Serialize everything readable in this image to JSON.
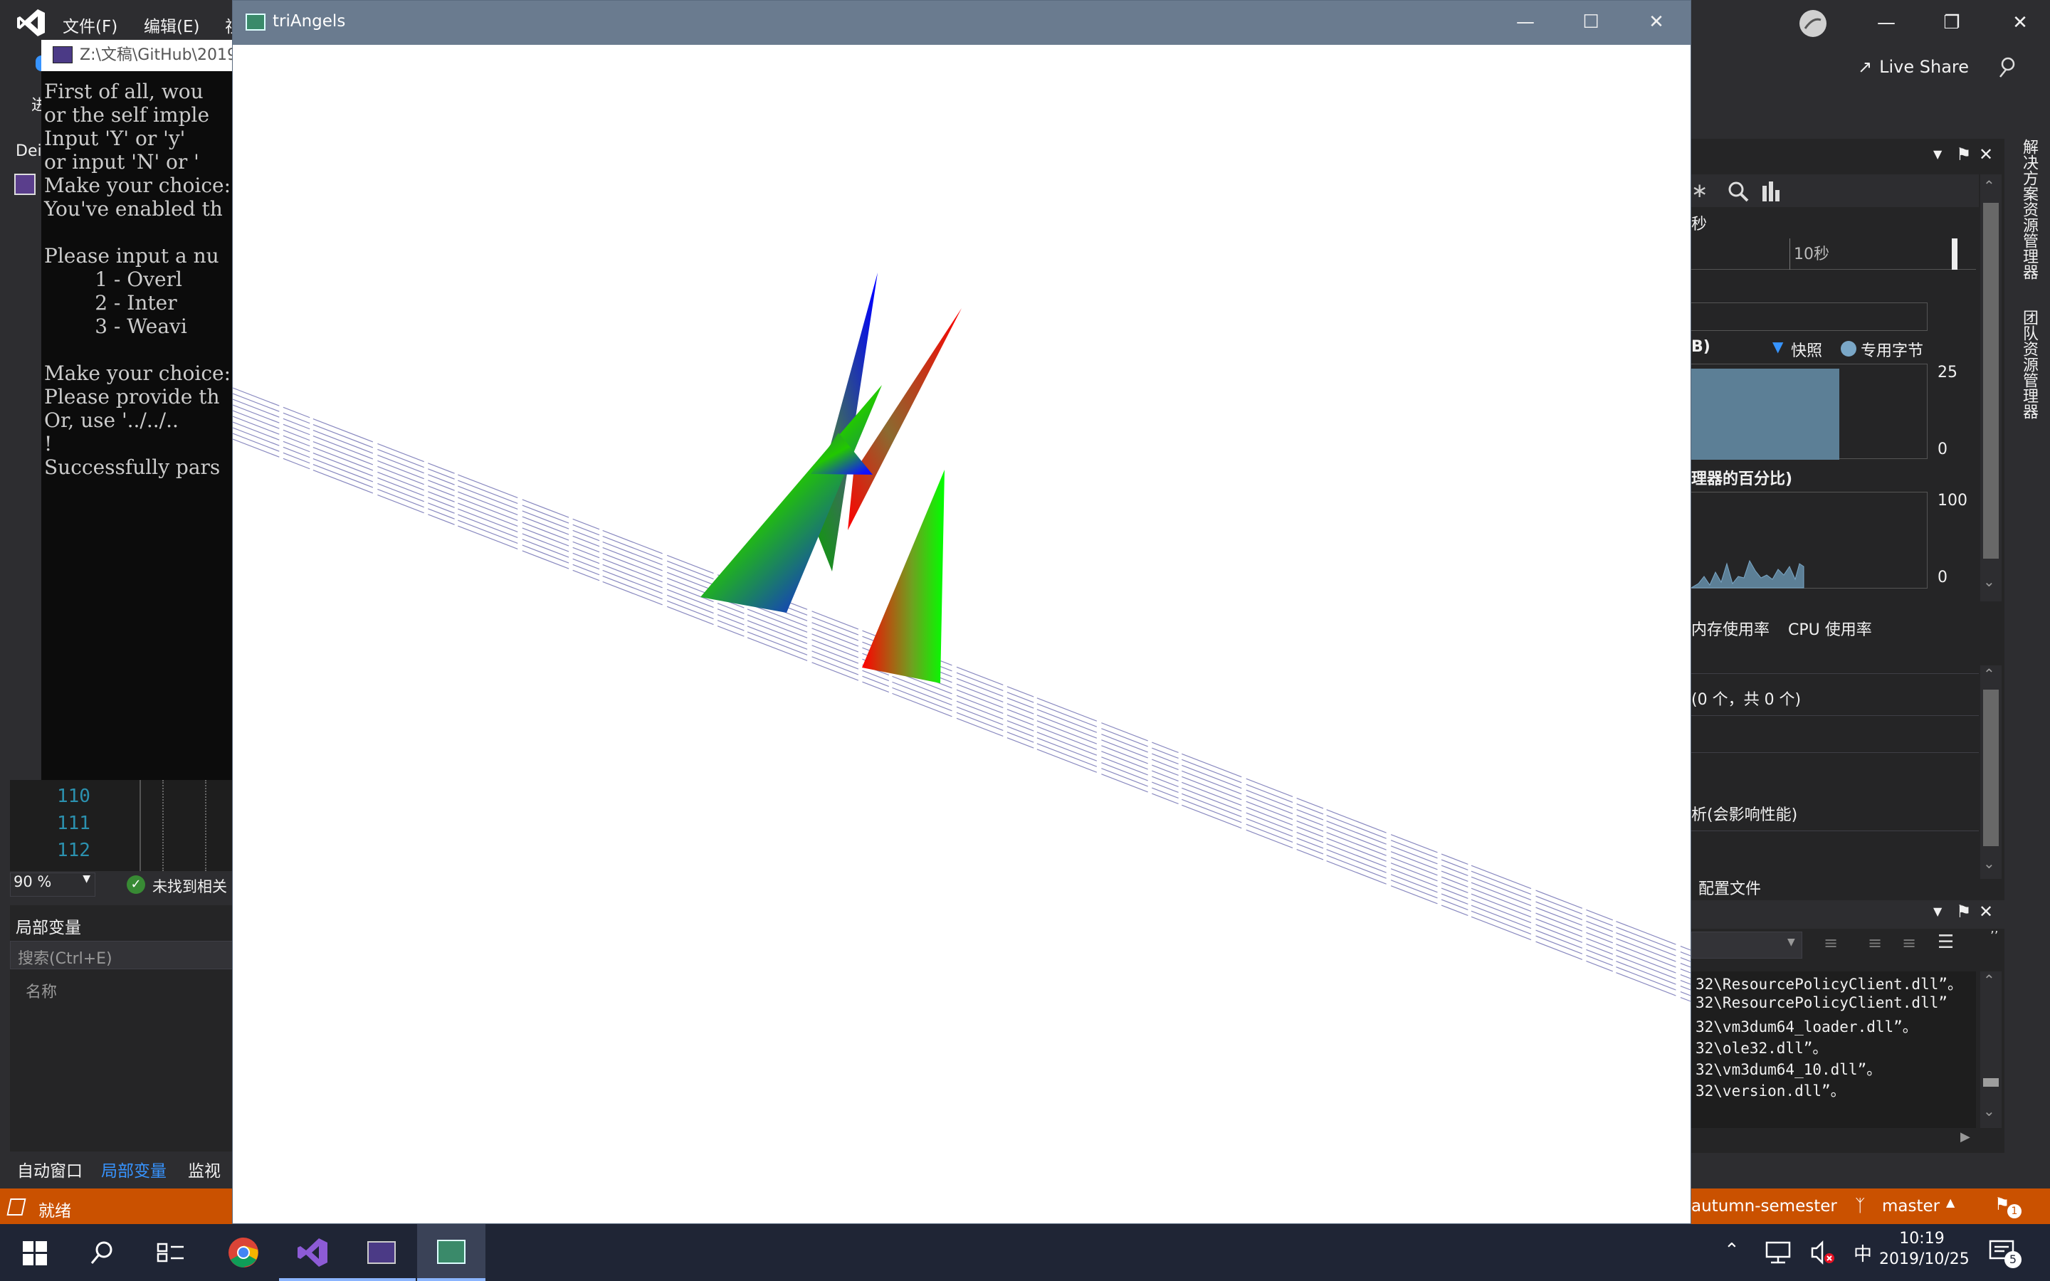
{
  "vs": {
    "menu": [
      "文件(F)",
      "编辑(E)",
      "视"
    ],
    "liveshare_label": "Live Share",
    "debug_tab_stub": "Dei",
    "toolbar_stub": "进"
  },
  "console": {
    "title": "Z:\\文稿\\GitHub\\2019",
    "lines": [
      "First of all, wou",
      "or the self imple",
      "Input 'Y' or 'y'",
      "or input 'N' or '",
      "Make your choice:",
      "You've enabled th",
      "",
      "Please input a nu",
      "        1 - Overl",
      "        2 - Inter",
      "        3 - Weavi",
      "",
      "Make your choice:",
      "Please provide th",
      "Or, use '../../..",
      "!",
      "Successfully pars"
    ]
  },
  "editor": {
    "line_numbers": [
      "110",
      "111",
      "112"
    ],
    "zoom": "90 %",
    "status_text": "未找到相关"
  },
  "locals": {
    "title": "局部变量",
    "search_placeholder": "搜索(Ctrl+E)",
    "column_name": "名称"
  },
  "debug_tabs": [
    "自动窗口",
    "局部变量",
    "监视"
  ],
  "glwindow": {
    "title": "triAngels"
  },
  "diagnostics": {
    "timeline_label": "10秒",
    "sec_label": "秒",
    "memory_label": "B)",
    "legend_snapshot": "快照",
    "legend_private": "专用字节",
    "mem_max": "25",
    "mem_min": "0",
    "cpu_title": "理器的百分比)",
    "cpu_max": "100",
    "cpu_min": "0",
    "tabs": [
      "内存使用率",
      "CPU 使用率"
    ],
    "events_count": "(0 个，共 0 个)",
    "analyze_text": "析(会影响性能)",
    "profile_text": "配置文件"
  },
  "output": {
    "lines": [
      "32\\ResourcePolicyClient.dll”。",
      "32\\ResourcePolicyClient.dll”",
      "32\\vm3dum64_loader.dll”。",
      "32\\ole32.dll”。",
      "32\\vm3dum64_10.dll”。",
      "32\\version.dll”。"
    ]
  },
  "right_strip": {
    "solution_explorer": "解决方案资源管理器",
    "team_explorer": "团队资源管理器"
  },
  "statusbar": {
    "ready": "就绪",
    "branch_folder": "autumn-semester",
    "branch": "master",
    "notifications": "1"
  },
  "taskbar": {
    "time": "10:19",
    "date": "2019/10/25",
    "ime": "中",
    "notif_count": "5"
  },
  "colors": {
    "vs_bg": "#2d2d30",
    "status_orange": "#ca5100",
    "taskbar": "#1f2535",
    "gl_title": "#6a7b8f"
  }
}
